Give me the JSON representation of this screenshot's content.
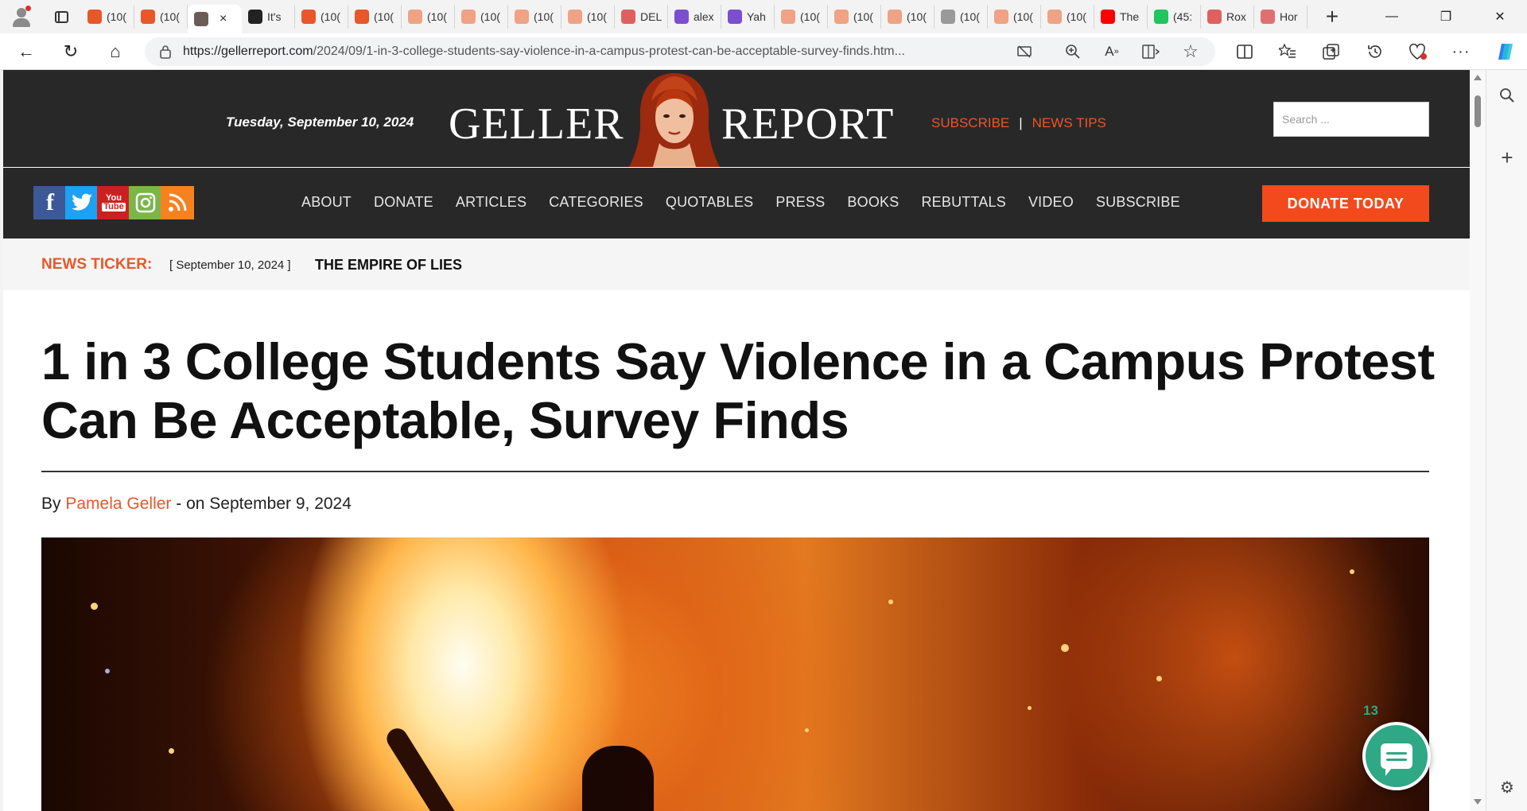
{
  "browser": {
    "tabs": [
      {
        "label": "(10(",
        "favicon_color": "#e8572a"
      },
      {
        "label": "(10(",
        "favicon_color": "#e8572a"
      },
      {
        "label": "",
        "favicon_color": "#6b5a55",
        "active": true,
        "close": "×"
      },
      {
        "label": "It's",
        "favicon_color": "#222222"
      },
      {
        "label": "(10(",
        "favicon_color": "#e8572a"
      },
      {
        "label": "(10(",
        "favicon_color": "#e8572a"
      },
      {
        "label": "(10(",
        "favicon_color": "#f0a284"
      },
      {
        "label": "(10(",
        "favicon_color": "#f0a284"
      },
      {
        "label": "(10(",
        "favicon_color": "#f0a284"
      },
      {
        "label": "(10(",
        "favicon_color": "#f0a284"
      },
      {
        "label": "DEL",
        "favicon_color": "#e06060"
      },
      {
        "label": "alex",
        "favicon_color": "#7b4fd0"
      },
      {
        "label": "Yah",
        "favicon_color": "#7b4fd0"
      },
      {
        "label": "(10(",
        "favicon_color": "#f0a284"
      },
      {
        "label": "(10(",
        "favicon_color": "#f0a284"
      },
      {
        "label": "(10(",
        "favicon_color": "#f0a284"
      },
      {
        "label": "(10(",
        "favicon_color": "#9a9a9a"
      },
      {
        "label": "(10(",
        "favicon_color": "#f0a284"
      },
      {
        "label": "(10(",
        "favicon_color": "#f0a284"
      },
      {
        "label": "The",
        "favicon_color": "#ff0000"
      },
      {
        "label": "(45:",
        "favicon_color": "#22c55e"
      },
      {
        "label": "Rox",
        "favicon_color": "#e06060"
      },
      {
        "label": "Hor",
        "favicon_color": "#e07070"
      }
    ],
    "new_tab": "+",
    "window": {
      "minimize": "—",
      "restore": "❐",
      "close": "✕"
    },
    "address": {
      "url_host": "https://gellerreport.com",
      "url_path": "/2024/09/1-in-3-college-students-say-violence-in-a-campus-protest-can-be-acceptable-survey-finds.htm..."
    },
    "icons": {
      "back": "←",
      "refresh": "↻",
      "home": "⌂",
      "favorite": "☆",
      "add": "+",
      "settings": "⚙",
      "search": "⌕"
    }
  },
  "site": {
    "date": "Tuesday, September 10, 2024",
    "logo_left": "GELLER",
    "logo_right": "REPORT",
    "subscribe": "SUBSCRIBE",
    "separator": "|",
    "news_tips": "NEWS TIPS",
    "search_placeholder": "Search ...",
    "social": [
      {
        "name": "facebook",
        "glyph": "f",
        "color": "#3b5998"
      },
      {
        "name": "twitter",
        "glyph": "t",
        "color": "#1da1f2"
      },
      {
        "name": "youtube",
        "glyph": "You Tube",
        "color": "#cc2020"
      },
      {
        "name": "instagram",
        "glyph": "◎",
        "color": "#7ab648"
      },
      {
        "name": "rss",
        "glyph": "))",
        "color": "#f58220"
      }
    ],
    "menu": [
      "ABOUT",
      "DONATE",
      "ARTICLES",
      "CATEGORIES",
      "QUOTABLES",
      "PRESS",
      "BOOKS",
      "REBUTTALS",
      "VIDEO",
      "SUBSCRIBE"
    ],
    "donate_button": "DONATE TODAY",
    "accent": "#e8572a"
  },
  "ticker": {
    "label": "NEWS TICKER:",
    "date": "[ September 10, 2024 ]",
    "headline": "THE EMPIRE OF LIES"
  },
  "article": {
    "title": "1 in 3 College Students Say Violence in a Campus Protest Can Be Acceptable, Survey Finds",
    "by": "By",
    "author": "Pamela Geller",
    "date_text": "- on September 9, 2024"
  },
  "comments": {
    "count": "13",
    "color": "#2ea885"
  }
}
